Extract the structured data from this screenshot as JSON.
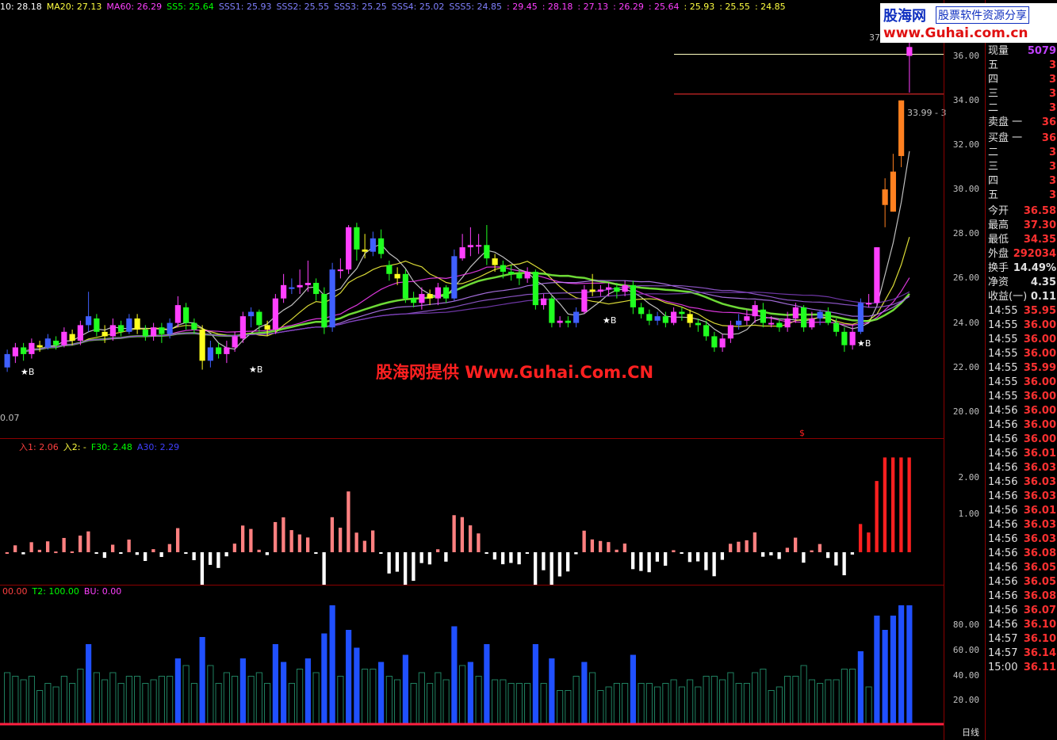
{
  "top_bar": {
    "items": [
      {
        "label": "10: 28.18",
        "color": "#ffffff"
      },
      {
        "label": "MA20: 27.13",
        "color": "#ffff40"
      },
      {
        "label": "MA60: 26.29",
        "color": "#ff40ff"
      },
      {
        "label": "SS5: 25.64",
        "color": "#00ff00"
      },
      {
        "label": "SSS1: 25.93",
        "color": "#8080ff"
      },
      {
        "label": "SSS2: 25.55",
        "color": "#8080ff"
      },
      {
        "label": "SSS3: 25.25",
        "color": "#8080ff"
      },
      {
        "label": "SSS4: 25.02",
        "color": "#8080ff"
      },
      {
        "label": "SSS5: 24.85",
        "color": "#8080ff"
      },
      {
        "label": ": 29.45",
        "color": "#ff40ff"
      },
      {
        "label": ": 28.18",
        "color": "#ff40ff"
      },
      {
        "label": ": 27.13",
        "color": "#ff40ff"
      },
      {
        "label": ": 26.29",
        "color": "#ff40ff"
      },
      {
        "label": ": 25.64",
        "color": "#ff40ff"
      },
      {
        "label": ": 25.93",
        "color": "#ffff40"
      },
      {
        "label": ": 25.55",
        "color": "#ffff40"
      },
      {
        "label": ": 24.85",
        "color": "#ffff40"
      }
    ]
  },
  "logo": {
    "name": "股海网",
    "tagline": "股票软件资源分享",
    "url": "www.Guhai.com.cn"
  },
  "watermark": "股海网提供 Www.Guhai.Com.CN",
  "main_labels": {
    "low_price": "0.07",
    "price_box": "33.99 - 3",
    "high_tag": "37",
    "marker_s": "$",
    "marker_b": "★B"
  },
  "sub1_label": {
    "items": [
      {
        "label": "入1: 2.06",
        "color": "#ff4040"
      },
      {
        "label": "入2: -",
        "color": "#ffff40"
      },
      {
        "label": "F30: 2.48",
        "color": "#00ff00"
      },
      {
        "label": "A30: 2.29",
        "color": "#4040ff"
      }
    ]
  },
  "sub2_label": {
    "items": [
      {
        "label": "00.00",
        "color": "#ff4040"
      },
      {
        "label": "T2: 100.00",
        "color": "#00ff00"
      },
      {
        "label": "BU: 0.00",
        "color": "#ff40ff"
      }
    ]
  },
  "axis": {
    "main": [
      "36.00",
      "34.00",
      "32.00",
      "30.00",
      "28.00",
      "26.00",
      "24.00",
      "22.00",
      "20.00"
    ],
    "sub1": [
      "2.00",
      "1.00"
    ],
    "sub2": [
      "80.00",
      "60.00",
      "40.00",
      "20.00"
    ],
    "bottom": "日线"
  },
  "quote_panel": {
    "current_volume": {
      "label": "现量",
      "value": "5079"
    },
    "sell": [
      {
        "label": "五",
        "value": "3"
      },
      {
        "label": "四",
        "value": "3"
      },
      {
        "label": "三",
        "value": "3"
      },
      {
        "label": "二",
        "value": "3"
      },
      {
        "label": "卖盘 一",
        "value": "36"
      }
    ],
    "buy": [
      {
        "label": "买盘 一",
        "value": "36"
      },
      {
        "label": "二",
        "value": "3"
      },
      {
        "label": "三",
        "value": "3"
      },
      {
        "label": "四",
        "value": "3"
      },
      {
        "label": "五",
        "value": "3"
      }
    ],
    "stats": [
      {
        "label": "今开",
        "value": "36.58",
        "color": "#ff3030"
      },
      {
        "label": "最高",
        "value": "37.30",
        "color": "#ff3030"
      },
      {
        "label": "最低",
        "value": "34.35",
        "color": "#ff3030"
      },
      {
        "label": "外盘",
        "value": "292034",
        "color": "#ff3030"
      },
      {
        "label": "换手",
        "value": "14.49%",
        "color": "#e0e0e0"
      },
      {
        "label": "净资",
        "value": "4.35",
        "color": "#e0e0e0"
      },
      {
        "label": "收益(一)",
        "value": "0.11",
        "color": "#e0e0e0"
      }
    ],
    "ticks": [
      {
        "time": "14:55",
        "price": "35.95",
        "color": "#ff3030"
      },
      {
        "time": "14:55",
        "price": "36.00",
        "color": "#ff3030"
      },
      {
        "time": "14:55",
        "price": "36.00",
        "color": "#ff3030"
      },
      {
        "time": "14:55",
        "price": "36.00",
        "color": "#ff3030"
      },
      {
        "time": "14:55",
        "price": "35.99",
        "color": "#ff3030"
      },
      {
        "time": "14:55",
        "price": "36.00",
        "color": "#ff3030"
      },
      {
        "time": "14:55",
        "price": "36.00",
        "color": "#ff3030"
      },
      {
        "time": "14:56",
        "price": "36.00",
        "color": "#ff3030"
      },
      {
        "time": "14:56",
        "price": "36.00",
        "color": "#ff3030"
      },
      {
        "time": "14:56",
        "price": "36.00",
        "color": "#ff3030"
      },
      {
        "time": "14:56",
        "price": "36.01",
        "color": "#ff3030"
      },
      {
        "time": "14:56",
        "price": "36.03",
        "color": "#ff3030"
      },
      {
        "time": "14:56",
        "price": "36.03",
        "color": "#ff3030"
      },
      {
        "time": "14:56",
        "price": "36.03",
        "color": "#ff3030"
      },
      {
        "time": "14:56",
        "price": "36.01",
        "color": "#ff3030"
      },
      {
        "time": "14:56",
        "price": "36.03",
        "color": "#ff3030"
      },
      {
        "time": "14:56",
        "price": "36.03",
        "color": "#ff3030"
      },
      {
        "time": "14:56",
        "price": "36.08",
        "color": "#ff3030"
      },
      {
        "time": "14:56",
        "price": "36.05",
        "color": "#ff3030"
      },
      {
        "time": "14:56",
        "price": "36.05",
        "color": "#ff3030"
      },
      {
        "time": "14:56",
        "price": "36.08",
        "color": "#ff3030"
      },
      {
        "time": "14:56",
        "price": "36.07",
        "color": "#ff3030"
      },
      {
        "time": "14:56",
        "price": "36.10",
        "color": "#ff3030"
      },
      {
        "time": "14:57",
        "price": "36.10",
        "color": "#ff3030"
      },
      {
        "time": "14:57",
        "price": "36.14",
        "color": "#ff3030"
      },
      {
        "time": "15:00",
        "price": "36.11",
        "color": "#ff3030"
      }
    ]
  },
  "chart_data": {
    "type": "candlestick",
    "title": "",
    "xlabel": "",
    "ylabel": "",
    "ylim": [
      19.0,
      37.8
    ],
    "grid": false,
    "series": [
      {
        "o": 22.0,
        "c": 22.6,
        "h": 22.8,
        "l": 21.8
      },
      {
        "o": 22.5,
        "c": 22.9,
        "h": 23.1,
        "l": 22.2
      },
      {
        "o": 22.9,
        "c": 22.6,
        "h": 23.1,
        "l": 22.3
      },
      {
        "o": 22.6,
        "c": 23.1,
        "h": 23.3,
        "l": 22.4
      },
      {
        "o": 23.0,
        "c": 22.9,
        "h": 23.2,
        "l": 22.7
      },
      {
        "o": 22.9,
        "c": 23.3,
        "h": 23.5,
        "l": 22.8
      },
      {
        "o": 23.2,
        "c": 23.0,
        "h": 23.4,
        "l": 22.8
      },
      {
        "o": 23.0,
        "c": 23.6,
        "h": 23.8,
        "l": 22.9
      },
      {
        "o": 23.5,
        "c": 23.2,
        "h": 23.7,
        "l": 23.0
      },
      {
        "o": 23.2,
        "c": 23.9,
        "h": 24.1,
        "l": 23.0
      },
      {
        "o": 23.9,
        "c": 24.3,
        "h": 25.4,
        "l": 23.6
      },
      {
        "o": 24.2,
        "c": 23.6,
        "h": 24.4,
        "l": 23.4
      },
      {
        "o": 23.6,
        "c": 23.4,
        "h": 23.9,
        "l": 23.1
      },
      {
        "o": 23.4,
        "c": 23.9,
        "h": 24.2,
        "l": 23.2
      },
      {
        "o": 23.9,
        "c": 23.6,
        "h": 24.1,
        "l": 23.4
      },
      {
        "o": 23.6,
        "c": 24.2,
        "h": 24.4,
        "l": 23.5
      },
      {
        "o": 24.2,
        "c": 23.7,
        "h": 24.4,
        "l": 23.5
      },
      {
        "o": 23.7,
        "c": 23.4,
        "h": 23.9,
        "l": 23.2
      },
      {
        "o": 23.4,
        "c": 23.8,
        "h": 24.0,
        "l": 23.2
      },
      {
        "o": 23.8,
        "c": 23.5,
        "h": 24.0,
        "l": 23.1
      },
      {
        "o": 23.5,
        "c": 24.0,
        "h": 24.2,
        "l": 23.3
      },
      {
        "o": 24.0,
        "c": 24.8,
        "h": 25.2,
        "l": 23.8
      },
      {
        "o": 24.7,
        "c": 24.0,
        "h": 24.9,
        "l": 23.7
      },
      {
        "o": 24.0,
        "c": 23.7,
        "h": 24.2,
        "l": 23.5
      },
      {
        "o": 23.7,
        "c": 22.3,
        "h": 23.9,
        "l": 21.9
      },
      {
        "o": 22.3,
        "c": 22.9,
        "h": 23.2,
        "l": 22.0
      },
      {
        "o": 22.9,
        "c": 22.6,
        "h": 23.1,
        "l": 22.4
      },
      {
        "o": 22.6,
        "c": 22.9,
        "h": 23.2,
        "l": 22.2
      },
      {
        "o": 22.9,
        "c": 23.4,
        "h": 23.6,
        "l": 22.7
      },
      {
        "o": 23.3,
        "c": 24.3,
        "h": 24.5,
        "l": 23.1
      },
      {
        "o": 24.3,
        "c": 24.5,
        "h": 24.7,
        "l": 23.8
      },
      {
        "o": 24.5,
        "c": 23.9,
        "h": 24.6,
        "l": 23.6
      },
      {
        "o": 23.9,
        "c": 23.7,
        "h": 24.1,
        "l": 23.4
      },
      {
        "o": 23.7,
        "c": 25.1,
        "h": 25.3,
        "l": 23.5
      },
      {
        "o": 25.1,
        "c": 25.7,
        "h": 26.2,
        "l": 24.9
      },
      {
        "o": 25.6,
        "c": 25.6,
        "h": 26.0,
        "l": 25.3
      },
      {
        "o": 25.6,
        "c": 25.7,
        "h": 26.4,
        "l": 25.3
      },
      {
        "o": 25.7,
        "c": 25.8,
        "h": 26.8,
        "l": 25.4
      },
      {
        "o": 25.8,
        "c": 25.3,
        "h": 26.0,
        "l": 25.0
      },
      {
        "o": 25.3,
        "c": 23.8,
        "h": 25.6,
        "l": 23.5
      },
      {
        "o": 23.8,
        "c": 26.4,
        "h": 26.7,
        "l": 23.6
      },
      {
        "o": 26.4,
        "c": 26.4,
        "h": 26.9,
        "l": 26.0
      },
      {
        "o": 26.4,
        "c": 28.3,
        "h": 28.4,
        "l": 26.2
      },
      {
        "o": 28.3,
        "c": 27.3,
        "h": 28.5,
        "l": 26.8
      },
      {
        "o": 27.3,
        "c": 27.2,
        "h": 28.0,
        "l": 26.9
      },
      {
        "o": 27.2,
        "c": 27.8,
        "h": 28.1,
        "l": 27.0
      },
      {
        "o": 27.8,
        "c": 27.1,
        "h": 28.2,
        "l": 26.9
      },
      {
        "o": 26.6,
        "c": 26.2,
        "h": 26.8,
        "l": 25.9
      },
      {
        "o": 26.2,
        "c": 26.0,
        "h": 26.5,
        "l": 25.7
      },
      {
        "o": 26.2,
        "c": 25.1,
        "h": 26.4,
        "l": 24.9
      },
      {
        "o": 25.1,
        "c": 24.9,
        "h": 25.4,
        "l": 24.7
      },
      {
        "o": 24.9,
        "c": 25.3,
        "h": 25.6,
        "l": 24.6
      },
      {
        "o": 25.3,
        "c": 25.1,
        "h": 25.5,
        "l": 24.8
      },
      {
        "o": 25.1,
        "c": 25.6,
        "h": 25.8,
        "l": 24.8
      },
      {
        "o": 25.6,
        "c": 25.1,
        "h": 25.7,
        "l": 24.9
      },
      {
        "o": 25.1,
        "c": 27.0,
        "h": 27.3,
        "l": 25.0
      },
      {
        "o": 26.9,
        "c": 27.4,
        "h": 28.0,
        "l": 26.8
      },
      {
        "o": 27.4,
        "c": 27.5,
        "h": 28.3,
        "l": 27.0
      },
      {
        "o": 27.5,
        "c": 27.5,
        "h": 28.0,
        "l": 27.1
      },
      {
        "o": 27.5,
        "c": 26.9,
        "h": 28.4,
        "l": 26.6
      },
      {
        "o": 26.9,
        "c": 26.6,
        "h": 27.1,
        "l": 26.3
      },
      {
        "o": 26.6,
        "c": 26.3,
        "h": 26.8,
        "l": 26.0
      },
      {
        "o": 26.3,
        "c": 26.2,
        "h": 26.6,
        "l": 25.9
      },
      {
        "o": 26.2,
        "c": 26.0,
        "h": 26.4,
        "l": 25.7
      },
      {
        "o": 26.0,
        "c": 26.3,
        "h": 26.5,
        "l": 25.8
      },
      {
        "o": 26.3,
        "c": 24.8,
        "h": 26.4,
        "l": 24.6
      },
      {
        "o": 24.8,
        "c": 25.1,
        "h": 25.3,
        "l": 24.6
      },
      {
        "o": 25.1,
        "c": 24.0,
        "h": 25.2,
        "l": 23.8
      },
      {
        "o": 24.0,
        "c": 24.1,
        "h": 24.3,
        "l": 23.8
      },
      {
        "o": 24.1,
        "c": 24.0,
        "h": 24.3,
        "l": 23.8
      },
      {
        "o": 24.0,
        "c": 24.5,
        "h": 24.7,
        "l": 23.8
      },
      {
        "o": 24.5,
        "c": 25.5,
        "h": 25.7,
        "l": 24.4
      },
      {
        "o": 25.5,
        "c": 25.4,
        "h": 26.2,
        "l": 25.2
      },
      {
        "o": 25.4,
        "c": 25.5,
        "h": 25.7,
        "l": 25.2
      },
      {
        "o": 25.5,
        "c": 25.6,
        "h": 25.8,
        "l": 25.2
      },
      {
        "o": 25.6,
        "c": 25.4,
        "h": 25.8,
        "l": 25.1
      },
      {
        "o": 25.4,
        "c": 25.7,
        "h": 25.9,
        "l": 25.2
      },
      {
        "o": 25.7,
        "c": 24.7,
        "h": 25.9,
        "l": 24.4
      },
      {
        "o": 24.7,
        "c": 24.4,
        "h": 24.9,
        "l": 24.2
      },
      {
        "o": 24.4,
        "c": 24.1,
        "h": 24.6,
        "l": 23.9
      },
      {
        "o": 24.1,
        "c": 24.3,
        "h": 24.5,
        "l": 23.9
      },
      {
        "o": 24.3,
        "c": 24.0,
        "h": 24.5,
        "l": 23.8
      },
      {
        "o": 24.0,
        "c": 24.5,
        "h": 24.7,
        "l": 23.9
      },
      {
        "o": 24.5,
        "c": 24.4,
        "h": 24.7,
        "l": 24.1
      },
      {
        "o": 24.4,
        "c": 24.0,
        "h": 24.6,
        "l": 23.8
      },
      {
        "o": 24.0,
        "c": 23.9,
        "h": 24.2,
        "l": 23.6
      },
      {
        "o": 23.9,
        "c": 23.4,
        "h": 24.1,
        "l": 23.2
      },
      {
        "o": 23.4,
        "c": 22.9,
        "h": 23.6,
        "l": 22.7
      },
      {
        "o": 22.9,
        "c": 23.3,
        "h": 23.5,
        "l": 22.7
      },
      {
        "o": 23.3,
        "c": 23.9,
        "h": 24.1,
        "l": 23.1
      },
      {
        "o": 23.9,
        "c": 24.1,
        "h": 24.4,
        "l": 23.7
      },
      {
        "o": 24.1,
        "c": 24.3,
        "h": 24.6,
        "l": 23.9
      },
      {
        "o": 24.3,
        "c": 24.8,
        "h": 25.0,
        "l": 24.0
      },
      {
        "o": 24.6,
        "c": 24.0,
        "h": 24.9,
        "l": 23.8
      },
      {
        "o": 24.0,
        "c": 24.0,
        "h": 24.3,
        "l": 23.8
      },
      {
        "o": 24.0,
        "c": 23.8,
        "h": 24.2,
        "l": 23.6
      },
      {
        "o": 23.8,
        "c": 24.2,
        "h": 24.5,
        "l": 23.6
      },
      {
        "o": 24.2,
        "c": 24.7,
        "h": 24.9,
        "l": 24.0
      },
      {
        "o": 24.7,
        "c": 23.8,
        "h": 24.8,
        "l": 23.6
      },
      {
        "o": 23.8,
        "c": 24.2,
        "h": 24.5,
        "l": 23.7
      },
      {
        "o": 24.2,
        "c": 24.5,
        "h": 24.6,
        "l": 23.9
      },
      {
        "o": 24.5,
        "c": 24.0,
        "h": 24.7,
        "l": 23.9
      },
      {
        "o": 24.0,
        "c": 23.6,
        "h": 24.2,
        "l": 23.4
      },
      {
        "o": 23.6,
        "c": 23.0,
        "h": 23.8,
        "l": 22.7
      },
      {
        "o": 23.0,
        "c": 23.6,
        "h": 23.9,
        "l": 22.8
      },
      {
        "o": 23.6,
        "c": 24.9,
        "h": 25.1,
        "l": 23.5
      },
      {
        "o": 24.9,
        "c": 24.9,
        "h": 25.3,
        "l": 24.7
      },
      {
        "o": 24.9,
        "c": 27.4,
        "h": 27.4,
        "l": 24.8
      },
      {
        "o": 29.3,
        "c": 30.0,
        "h": 30.5,
        "l": 28.3
      },
      {
        "o": 29.0,
        "c": 30.8,
        "h": 31.6,
        "l": 29.0
      },
      {
        "o": 31.5,
        "c": 34.0,
        "h": 34.0,
        "l": 31.0
      },
      {
        "o": 36.0,
        "c": 36.4,
        "h": 37.3,
        "l": 34.35
      }
    ]
  }
}
